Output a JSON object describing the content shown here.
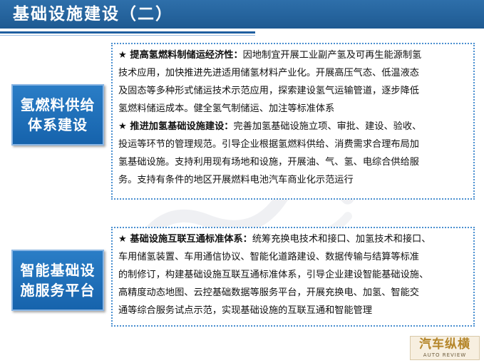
{
  "slide": {
    "title": "基础设施建设（二）"
  },
  "sections": [
    {
      "label_lines": [
        "氢燃料供给",
        "体系建设"
      ],
      "lines": [
        {
          "bold": "★ 提高氢燃料制储运经济性：",
          "text": "因地制宜开展工业副产氢及可再生能源制氢"
        },
        {
          "bold": "",
          "text": "技术应用，加快推进先进适用储氢材料产业化。开展高压气态、低温液态"
        },
        {
          "bold": "",
          "text": "及固态等多种形式储运技术示范应用，探索建设氢气运输管道，逐步降低"
        },
        {
          "bold": "",
          "text": "氢燃料储运成本。健全氢气制储运、加注等标准体系"
        },
        {
          "bold": "★ 推进加氢基础设施建设：",
          "text": "完善加氢基础设施立项、审批、建设、验收、"
        },
        {
          "bold": "",
          "text": "投运等环节的管理规范。引导企业根据氢燃料供给、消费需求合理布局加"
        },
        {
          "bold": "",
          "text": "氢基础设施。支持利用现有场地和设施，开展油、气、氢、电综合供给服"
        },
        {
          "bold": "",
          "text": "务。支持有条件的地区开展燃料电池汽车商业化示范运行"
        }
      ]
    },
    {
      "label_lines": [
        "智能基础设",
        "施服务平台"
      ],
      "lines": [
        {
          "bold": "★ 基础设施互联互通标准体系：",
          "text": "统筹充换电技术和接口、加氢技术和接口、"
        },
        {
          "bold": "",
          "text": "车用储氢装置、车用通信协议、智能化道路建设、数据传输与结算等标准"
        },
        {
          "bold": "",
          "text": "的制修订，构建基础设施互联互通标准体系，引导企业建设智能基础设施、"
        },
        {
          "bold": "",
          "text": "高精度动态地图、云控基础数据等服务平台，开展充换电、加氢、智能交"
        },
        {
          "bold": "",
          "text": "通等综合服务试点示范，实现基础设施的互联互通和智能管理"
        }
      ]
    }
  ],
  "logo": {
    "main": "汽车纵横",
    "sub": "AUTO REVIEW"
  }
}
